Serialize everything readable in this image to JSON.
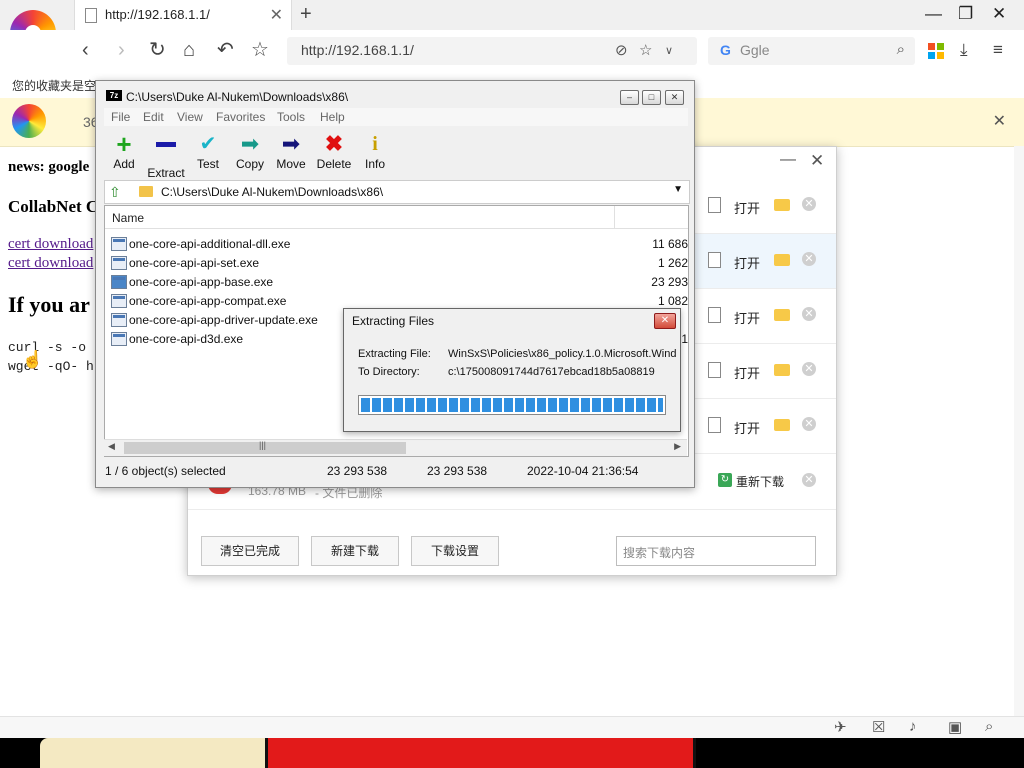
{
  "browser": {
    "tab_title": "http://192.168.1.1/",
    "tab_close": "✕",
    "new_tab": "+",
    "url": "http://192.168.1.1/",
    "search_engine_letter": "G",
    "search_placeholder": "Ggle",
    "bookmarks_hint": "您的收藏夹是空",
    "notice_text": "36",
    "win_controls": [
      "—",
      "❐",
      "✕"
    ]
  },
  "page": {
    "line1": "news: google",
    "line2": "CollabNet C",
    "link1": "cert download",
    "link2": "cert download",
    "heading": "If you ar",
    "code1": "curl -s -o",
    "code2": "wget -qO- h"
  },
  "download_manager": {
    "rows": [
      {
        "action": "打开"
      },
      {
        "action": "打开"
      },
      {
        "action": "打开"
      },
      {
        "action": "打开"
      },
      {
        "action": "打开"
      }
    ],
    "last_row": {
      "size": "163.78 MB",
      "note": "- 文件已删除",
      "action": "重新下载"
    },
    "buttons": {
      "clear": "清空已完成",
      "new": "新建下载",
      "settings": "下载设置"
    },
    "search_placeholder": "搜索下载内容"
  },
  "sevenzip": {
    "title": "C:\\Users\\Duke Al-Nukem\\Downloads\\x86\\",
    "app_icon": "7z",
    "menu": [
      "File",
      "Edit",
      "View",
      "Favorites",
      "Tools",
      "Help"
    ],
    "toolbar": [
      "Add",
      "Extract",
      "Test",
      "Copy",
      "Move",
      "Delete",
      "Info"
    ],
    "path": "C:\\Users\\Duke Al-Nukem\\Downloads\\x86\\",
    "column_name": "Name",
    "files": [
      {
        "name": "one-core-api-additional-dll.exe",
        "size": "11 686"
      },
      {
        "name": "one-core-api-api-set.exe",
        "size": "1 262"
      },
      {
        "name": "one-core-api-app-base.exe",
        "size": "23 293"
      },
      {
        "name": "one-core-api-app-compat.exe",
        "size": "1 082"
      },
      {
        "name": "one-core-api-app-driver-update.exe",
        "size": ""
      },
      {
        "name": "one-core-api-d3d.exe",
        "size": "1"
      }
    ],
    "status": {
      "selected": "1 / 6 object(s) selected",
      "size": "23 293 538",
      "packed": "23 293 538",
      "modified": "2022-10-04 21:36:54"
    }
  },
  "extract_dialog": {
    "title": "Extracting Files",
    "file_label": "Extracting File:",
    "file_value": "WinSxS\\Policies\\x86_policy.1.0.Microsoft.Wind",
    "dir_label": "To Directory:",
    "dir_value": "c:\\175008091744d7617ebcad18b5a08819",
    "progress": 1.0
  },
  "icons": [
    "page-icon",
    "back-icon",
    "forward-icon",
    "reload-icon",
    "home-icon",
    "undo-icon",
    "star-icon",
    "download-icon",
    "menu-icon",
    "search-icon"
  ]
}
